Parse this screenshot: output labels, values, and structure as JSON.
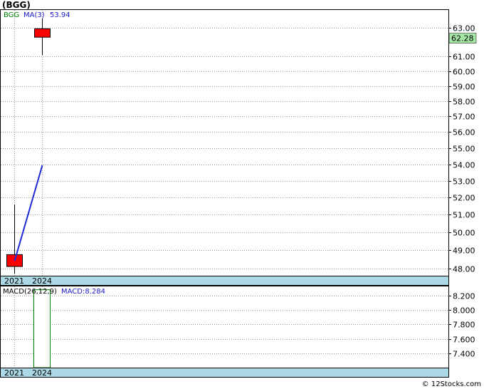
{
  "ticker_title": "(BGG)",
  "footer_credit": "© 12Stocks.com",
  "colors": {
    "grid": "#999999",
    "candle_up": "#ff0000",
    "ma_line": "#1f2ad6",
    "label_bg": "#add8e6",
    "last_price_bg": "#a6e6a6",
    "ticker_text": "#008000",
    "ma_text": "#1a1acc",
    "macd_bar": "#008000"
  },
  "chart_data": [
    {
      "type": "candlestick",
      "title": "",
      "legend": {
        "ticker": "BGG",
        "ma_label": "MA(3)",
        "ma_value": "53.94"
      },
      "categories": [
        "2021",
        "2024"
      ],
      "candles": [
        {
          "x": "2021",
          "open": 48.1,
          "close": 48.75,
          "high": 51.6,
          "low": 47.7
        },
        {
          "x": "2024",
          "open": 62.35,
          "close": 62.95,
          "high": 63.7,
          "low": 61.1
        }
      ],
      "ma_series": {
        "name": "MA(3)",
        "values": [
          48.4,
          53.94
        ]
      },
      "last_price": "62.28",
      "last_price_value": 62.28,
      "y_ticks": [
        "48.00",
        "49.00",
        "50.00",
        "51.00",
        "52.00",
        "53.00",
        "54.00",
        "55.00",
        "56.00",
        "57.00",
        "58.00",
        "59.00",
        "60.00",
        "61.00",
        "63.00"
      ],
      "ylim": [
        47.6,
        64.3
      ],
      "scale": "log",
      "grid": true
    },
    {
      "type": "bar",
      "title": "",
      "legend": {
        "label": "MACD(26,12,9)",
        "value_label": "MACD:8.284"
      },
      "categories": [
        "2021",
        "2024"
      ],
      "values": [
        null,
        8.284
      ],
      "y_ticks": [
        "7.400",
        "7.600",
        "7.800",
        "8.000",
        "8.200"
      ],
      "ylim": [
        7.2,
        8.33
      ],
      "grid": true
    }
  ]
}
